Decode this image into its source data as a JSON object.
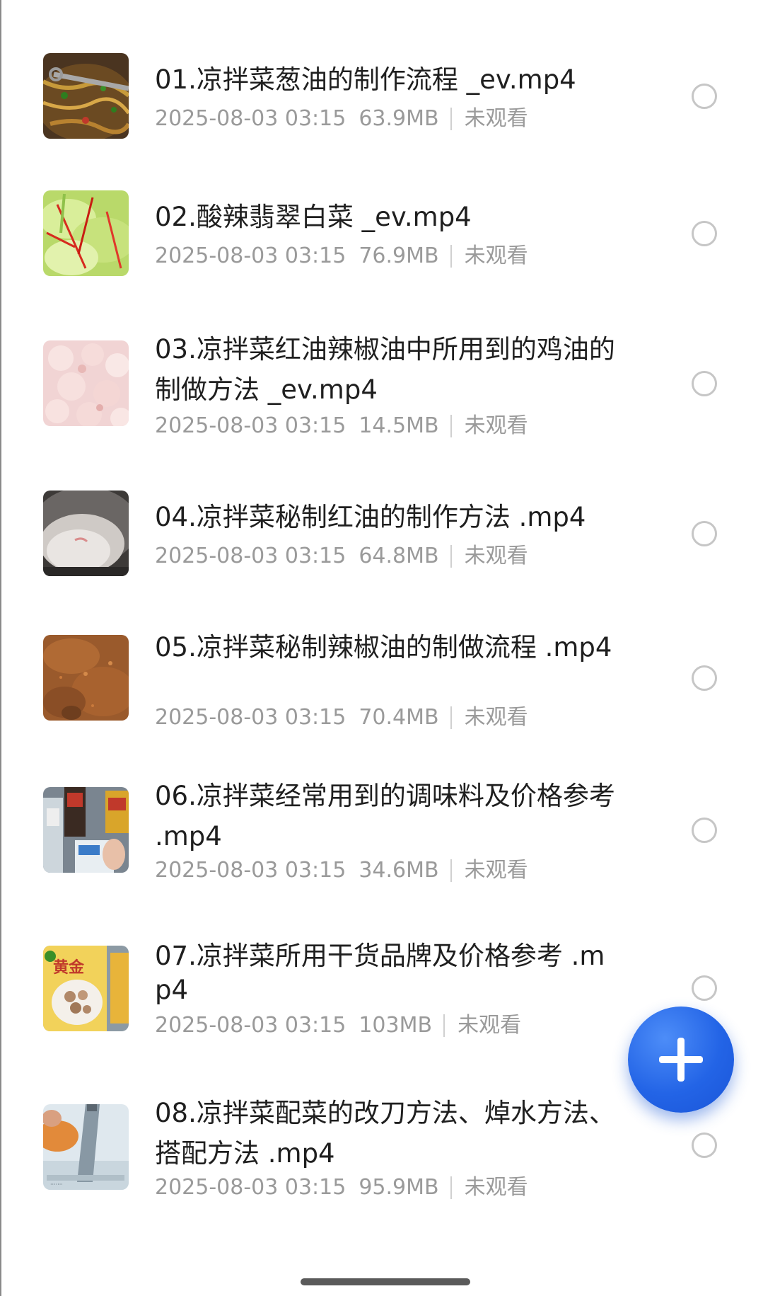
{
  "files": [
    {
      "title": "01.凉拌菜葱油的制作流程 _ev.mp4",
      "date": "2025-08-03 03:15",
      "size": "63.9MB",
      "status": "未观看",
      "thumb": "thumbnail-noodles-wok-icon"
    },
    {
      "title": "02.酸辣翡翠白菜 _ev.mp4",
      "date": "2025-08-03 03:15",
      "size": "76.9MB",
      "status": "未观看",
      "thumb": "thumbnail-cabbage-salad-icon"
    },
    {
      "title": "03.凉拌菜红油辣椒油中所用到的鸡油的制做方法 _ev.mp4",
      "date": "2025-08-03 03:15",
      "size": "14.5MB",
      "status": "未观看",
      "thumb": "thumbnail-chicken-fat-icon"
    },
    {
      "title": "04.凉拌菜秘制红油的制作方法 .mp4",
      "date": "2025-08-03 03:15",
      "size": "64.8MB",
      "status": "未观看",
      "thumb": "thumbnail-red-oil-pot-icon"
    },
    {
      "title": "05.凉拌菜秘制辣椒油的制做流程 .mp4",
      "date": "2025-08-03 03:15",
      "size": "70.4MB",
      "status": "未观看",
      "thumb": "thumbnail-chili-oil-icon"
    },
    {
      "title": "06.凉拌菜经常用到的调味料及价格参考 .mp4",
      "date": "2025-08-03 03:15",
      "size": "34.6MB",
      "status": "未观看",
      "thumb": "thumbnail-seasonings-icon"
    },
    {
      "title": "07.凉拌菜所用干货品牌及价格参考 .mp4",
      "date": "2025-08-03 03:15",
      "size": "103MB",
      "status": "未观看",
      "thumb": "thumbnail-dry-goods-icon"
    },
    {
      "title": "08.凉拌菜配菜的改刀方法、焯水方法、搭配方法 .mp4",
      "date": "2025-08-03 03:15",
      "size": "95.9MB",
      "status": "未观看",
      "thumb": "thumbnail-cutting-carrot-icon"
    }
  ],
  "fab": {
    "icon": "plus-icon",
    "color": "#2364e6"
  },
  "colors": {
    "title": "#1f1f1f",
    "meta": "#9a9a9a",
    "radio": "#c6c6c6"
  }
}
